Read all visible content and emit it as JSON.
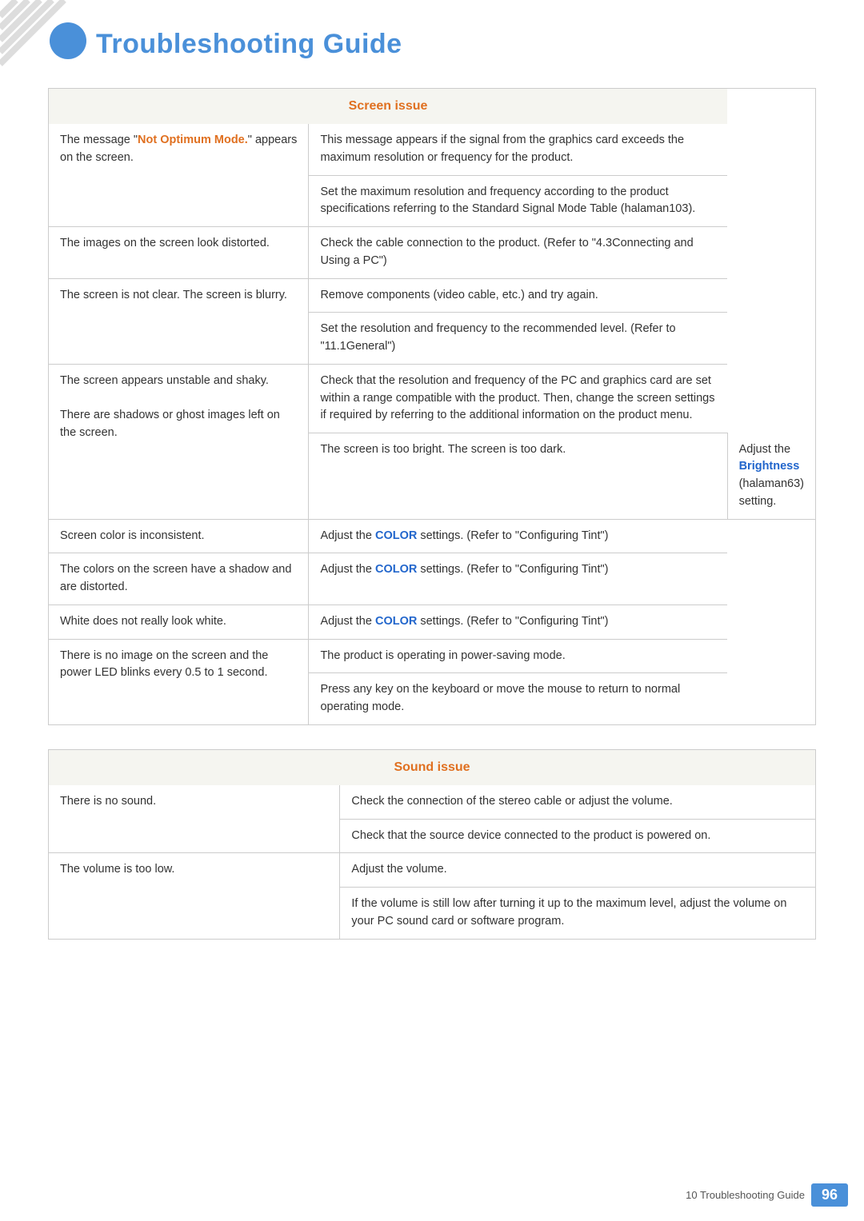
{
  "page": {
    "title": "Troubleshooting Guide",
    "chapter_num": "",
    "footer_label": "10 Troubleshooting Guide",
    "page_number": "96"
  },
  "screen_table": {
    "header": "Screen issue",
    "rows": [
      {
        "symptom": "The message \"Not Optimum Mode.\" appears on the screen.",
        "symptom_bold": "Not Optimum Mode.",
        "symptom_pre": "The message \"",
        "symptom_post": "\" appears on the screen.",
        "solutions": [
          "This message appears if the signal from the graphics card exceeds the maximum resolution or frequency for the product.",
          "Set the maximum resolution and frequency according to the product specifications referring to the Standard Signal Mode Table (halaman103)."
        ]
      },
      {
        "symptom": "The images on the screen look distorted.",
        "symptom_bold": "",
        "solutions": [
          "Check the cable connection to the product. (Refer to \"4.3Connecting and Using a PC\")"
        ]
      },
      {
        "symptom": "The screen is not clear. The screen is blurry.",
        "symptom_bold": "",
        "solutions": [
          "Remove components (video cable, etc.) and try again.",
          "Set the resolution and frequency to the recommended level. (Refer to \"11.1General\")"
        ]
      },
      {
        "symptom": "The screen appears unstable and shaky.",
        "symptom2": "There are shadows or ghost images left on the screen.",
        "symptom_bold": "",
        "solutions": [
          "Check that the resolution and frequency of the PC and graphics card are set within a range compatible with the product. Then, change the screen settings if required by referring to the additional information on the product menu."
        ]
      },
      {
        "symptom": "The screen is too bright. The screen is too dark.",
        "symptom_bold": "",
        "solutions": [
          "Adjust the Brightness (halaman63) setting."
        ],
        "solutions_bold": [
          "Brightness"
        ]
      },
      {
        "symptom": "Screen color is inconsistent.",
        "symptom_bold": "",
        "solutions": [
          "Adjust the COLOR settings. (Refer to \"Configuring Tint\")"
        ],
        "solutions_bold": [
          "COLOR"
        ]
      },
      {
        "symptom": "The colors on the screen have a shadow and are distorted.",
        "symptom_bold": "",
        "solutions": [
          "Adjust the COLOR settings. (Refer to \"Configuring Tint\")"
        ],
        "solutions_bold": [
          "COLOR"
        ]
      },
      {
        "symptom": "White does not really look white.",
        "symptom_bold": "",
        "solutions": [
          "Adjust the COLOR settings. (Refer to \"Configuring Tint\")"
        ],
        "solutions_bold": [
          "COLOR"
        ]
      },
      {
        "symptom": "There is no image on the screen and the power LED blinks every 0.5 to 1 second.",
        "symptom_bold": "",
        "solutions": [
          "The product is operating in power-saving mode.",
          "Press any key on the keyboard or move the mouse to return to normal operating mode."
        ]
      }
    ]
  },
  "sound_table": {
    "header": "Sound issue",
    "rows": [
      {
        "symptom": "There is no sound.",
        "solutions": [
          "Check the connection of the stereo cable or adjust the volume.",
          "Check that the source device connected to the product is powered on."
        ]
      },
      {
        "symptom": "The volume is too low.",
        "solutions": [
          "Adjust the volume.",
          "If the volume is still low after turning it up to the maximum level, adjust the volume on your PC sound card or software program."
        ]
      }
    ]
  }
}
